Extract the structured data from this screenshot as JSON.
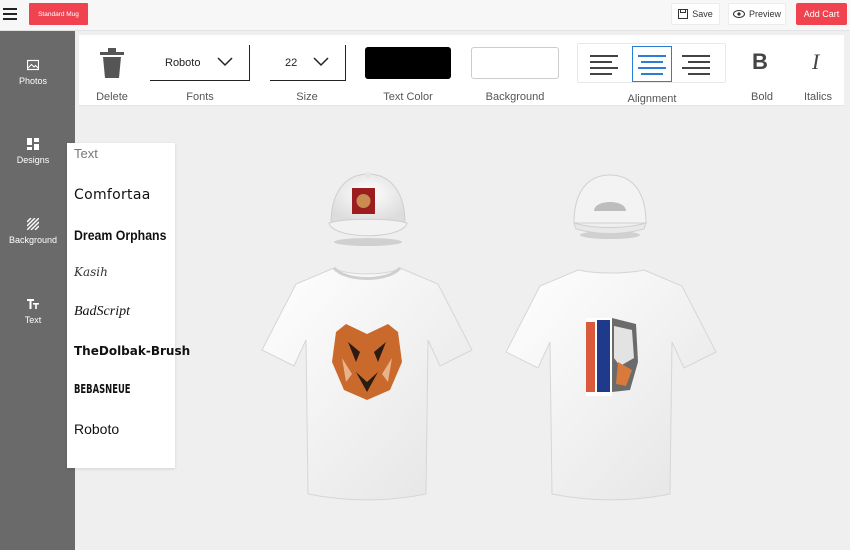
{
  "topbar": {
    "brand_label": "Standard Mug",
    "save_label": "Save",
    "preview_label": "Preview",
    "add_cart_label": "Add Cart"
  },
  "sidebar": {
    "items": [
      {
        "label": "Photos",
        "icon": "image-icon"
      },
      {
        "label": "Designs",
        "icon": "grid-icon"
      },
      {
        "label": "Background",
        "icon": "stripes-icon"
      },
      {
        "label": "Text",
        "icon": "text-icon"
      }
    ]
  },
  "toolbar": {
    "delete_label": "Delete",
    "fonts_label": "Fonts",
    "font_value": "Roboto",
    "size_label": "Size",
    "size_value": "22",
    "text_color_label": "Text Color",
    "text_color": "#000000",
    "background_label": "Background",
    "background_color": "#ffffff",
    "alignment_label": "Alignment",
    "alignment_selected": "center",
    "bold_label": "Bold",
    "italics_label": "Italics"
  },
  "font_panel": {
    "title": "Text",
    "fonts": [
      "Comfortaa",
      "Dream Orphans",
      "Kasih",
      "BadScript",
      "TheDolbak-Brush",
      "BEBASNEUE",
      "Roboto"
    ]
  },
  "colors": {
    "accent": "#f0434f",
    "sidebar": "#6a6a6a",
    "active_align": "#2a7fd4"
  }
}
